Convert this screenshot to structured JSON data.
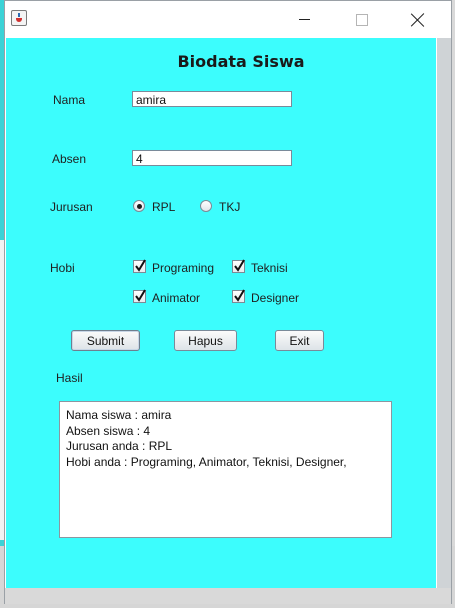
{
  "window": {
    "title": ""
  },
  "form": {
    "heading": "Biodata Siswa",
    "nama": {
      "label": "Nama",
      "value": "amira"
    },
    "absen": {
      "label": "Absen",
      "value": "4"
    },
    "jurusan": {
      "label": "Jurusan",
      "options": [
        "RPL",
        "TKJ"
      ],
      "selected": "RPL"
    },
    "hobi": {
      "label": "Hobi",
      "options": [
        {
          "label": "Programing",
          "checked": true
        },
        {
          "label": "Teknisi",
          "checked": true
        },
        {
          "label": "Animator",
          "checked": true
        },
        {
          "label": "Designer",
          "checked": true
        }
      ]
    },
    "buttons": {
      "submit": "Submit",
      "hapus": "Hapus",
      "exit": "Exit"
    },
    "hasil_label": "Hasil",
    "hasil_lines": [
      "Nama siswa : amira",
      "Absen siswa : 4",
      "Jurusan anda : RPL",
      "Hobi anda : Programing, Animator, Teknisi, Designer,"
    ]
  },
  "icons": {
    "app": "java-app-icon",
    "min": "minimize-icon",
    "max": "maximize-icon",
    "close": "close-icon"
  }
}
